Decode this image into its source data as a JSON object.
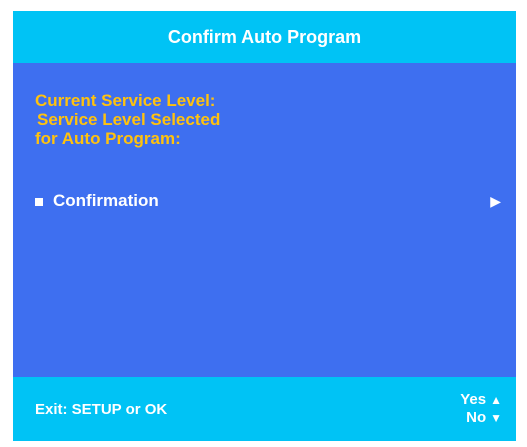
{
  "title": "Confirm Auto Program",
  "info": {
    "line1": "Current Service Level:",
    "line2": "Service Level Selected",
    "line3": "for Auto Program:"
  },
  "menu": {
    "item_label": "Confirmation"
  },
  "footer": {
    "exit_hint": "Exit:  SETUP or OK",
    "yes_label": "Yes",
    "no_label": "No"
  },
  "colors": {
    "title_bar": "#00c3f5",
    "main_bg": "#3e6ff0",
    "accent_text": "#ffc20e",
    "text": "#ffffff"
  },
  "icons": {
    "bullet": "square-bullet-icon",
    "submenu": "play-arrow-icon",
    "yes": "triangle-up-icon",
    "no": "triangle-down-icon"
  }
}
